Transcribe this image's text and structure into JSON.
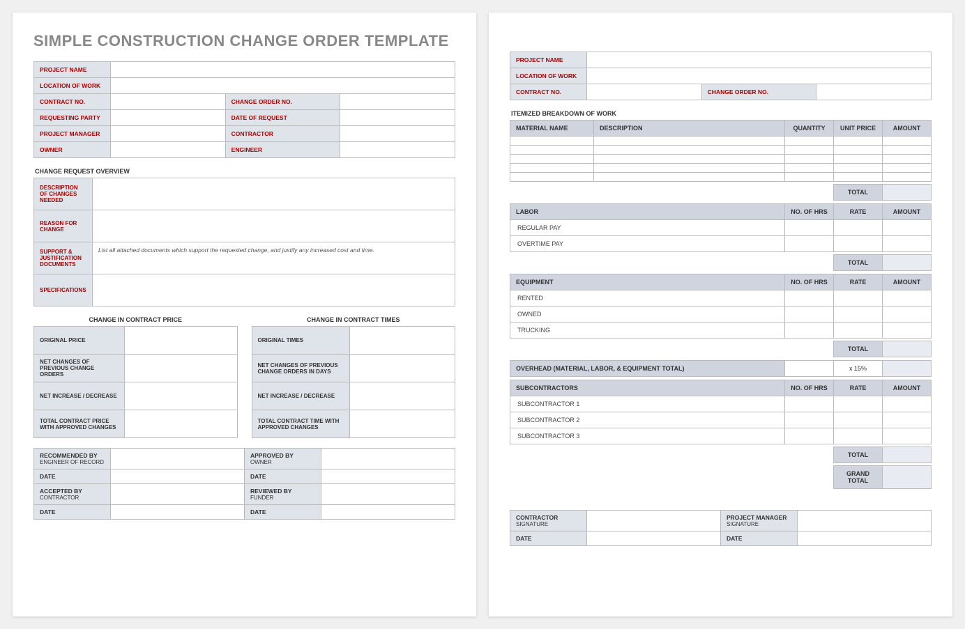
{
  "title": "SIMPLE CONSTRUCTION CHANGE ORDER TEMPLATE",
  "header": {
    "project_name": "PROJECT NAME",
    "location": "LOCATION OF WORK",
    "contract_no": "CONTRACT NO.",
    "change_order_no": "CHANGE ORDER NO.",
    "requesting_party": "REQUESTING PARTY",
    "date_of_request": "DATE OF REQUEST",
    "project_manager": "PROJECT MANAGER",
    "contractor": "CONTRACTOR",
    "owner": "OWNER",
    "engineer": "ENGINEER"
  },
  "overview": {
    "title": "CHANGE REQUEST OVERVIEW",
    "desc": "DESCRIPTION OF CHANGES NEEDED",
    "reason": "REASON FOR CHANGE",
    "support": "SUPPORT & JUSTIFICATION DOCUMENTS",
    "support_note": "List all attached documents which support the requested change, and justify any increased cost and time.",
    "specs": "SPECIFICATIONS"
  },
  "price": {
    "title": "CHANGE IN CONTRACT PRICE",
    "original": "ORIGINAL PRICE",
    "net_prev": "NET CHANGES OF PREVIOUS CHANGE ORDERS",
    "net_inc": "NET INCREASE / DECREASE",
    "total": "TOTAL CONTRACT PRICE WITH APPROVED CHANGES"
  },
  "times": {
    "title": "CHANGE IN CONTRACT TIMES",
    "original": "ORIGINAL TIMES",
    "net_prev": "NET CHANGES OF PREVIOUS CHANGE ORDERS IN DAYS",
    "net_inc": "NET INCREASE / DECREASE",
    "total": "TOTAL CONTRACT TIME WITH APPROVED CHANGES"
  },
  "sig1": {
    "rec_by": "RECOMMENDED BY",
    "rec_sub": "ENGINEER OF RECORD",
    "approved_by": "APPROVED BY",
    "approved_sub": "OWNER",
    "accepted_by": "ACCEPTED BY",
    "accepted_sub": "CONTRACTOR",
    "reviewed_by": "REVIEWED BY",
    "reviewed_sub": "FUNDER",
    "date": "DATE"
  },
  "page2": {
    "header_project_name": "PROJECT NAME",
    "header_location": "LOCATION OF WORK",
    "header_contract_no": "CONTRACT NO.",
    "header_change_order_no": "CHANGE ORDER NO.",
    "itemized_title": "ITEMIZED BREAKDOWN OF WORK",
    "material": {
      "name": "MATERIAL NAME",
      "desc": "DESCRIPTION",
      "qty": "QUANTITY",
      "unit": "UNIT PRICE",
      "amount": "AMOUNT"
    },
    "total": "TOTAL",
    "labor": {
      "title": "LABOR",
      "hrs": "NO. OF HRS",
      "rate": "RATE",
      "amount": "AMOUNT",
      "regular": "REGULAR PAY",
      "overtime": "OVERTIME PAY"
    },
    "equipment": {
      "title": "EQUIPMENT",
      "hrs": "NO. OF HRS",
      "rate": "RATE",
      "amount": "AMOUNT",
      "rented": "RENTED",
      "owned": "OWNED",
      "trucking": "TRUCKING"
    },
    "overhead": {
      "title": "OVERHEAD (MATERIAL, LABOR, & EQUIPMENT TOTAL)",
      "rate": "x 15%"
    },
    "subs": {
      "title": "SUBCONTRACTORS",
      "hrs": "NO. OF HRS",
      "rate": "RATE",
      "amount": "AMOUNT",
      "s1": "SUBCONTRACTOR 1",
      "s2": "SUBCONTRACTOR 2",
      "s3": "SUBCONTRACTOR 3"
    },
    "grand_total": "GRAND TOTAL",
    "sig": {
      "contractor": "CONTRACTOR",
      "signature": "SIGNATURE",
      "pm": "PROJECT MANAGER",
      "date": "DATE"
    }
  }
}
